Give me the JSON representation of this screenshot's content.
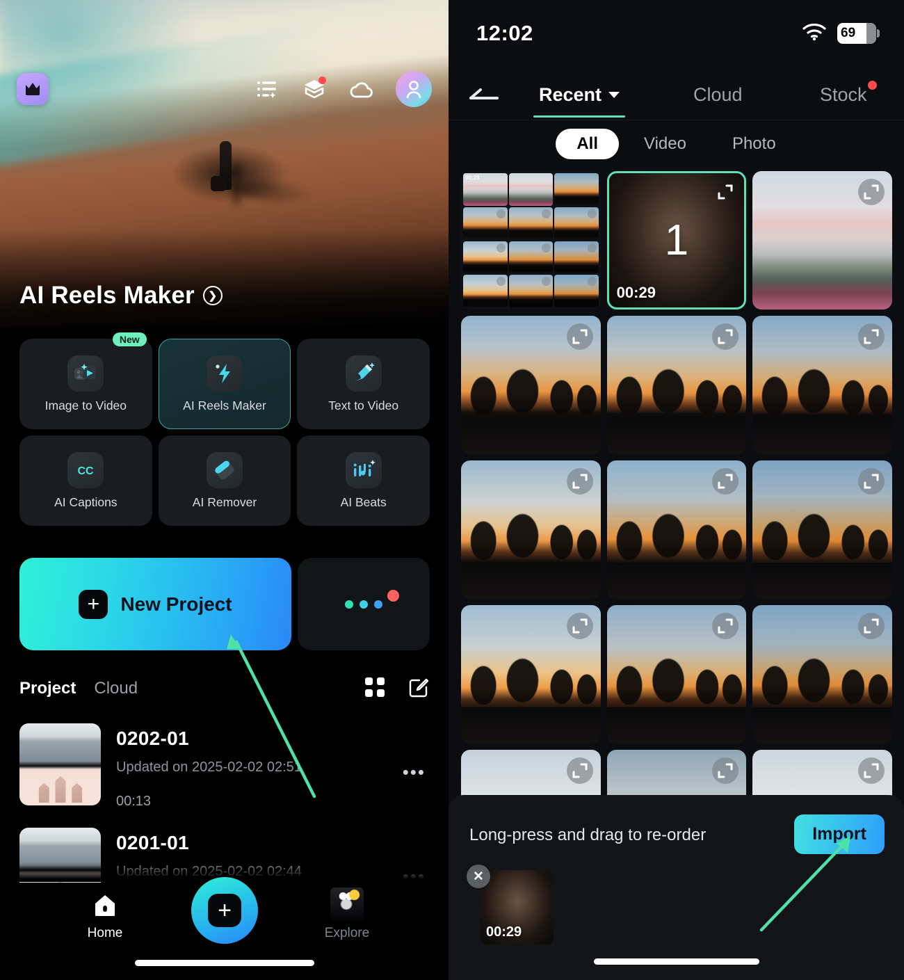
{
  "left_phone": {
    "header": {
      "crown_icon": "crown-icon",
      "icons": [
        {
          "name": "ai-script-icon",
          "badge": false
        },
        {
          "name": "tutorial-icon",
          "badge": true
        },
        {
          "name": "cloud-icon",
          "badge": false
        }
      ],
      "avatar": "profile-avatar"
    },
    "hero": {
      "title": "AI Reels Maker",
      "arrow_icon": "chevron-right-circle-icon"
    },
    "tools": [
      {
        "label": "Image to Video",
        "icon": "image-to-video-icon",
        "badge": "New",
        "active": false
      },
      {
        "label": "AI Reels Maker",
        "icon": "lightning-icon",
        "badge": "",
        "active": true
      },
      {
        "label": "Text  to Video",
        "icon": "pencil-icon",
        "badge": "",
        "active": false
      },
      {
        "label": "AI Captions",
        "icon": "cc-icon",
        "badge": "",
        "active": false
      },
      {
        "label": "AI Remover",
        "icon": "eraser-icon",
        "badge": "",
        "active": false
      },
      {
        "label": "AI Beats",
        "icon": "music-bars-icon",
        "badge": "",
        "active": false
      }
    ],
    "new_project": {
      "label": "New Project",
      "plus_icon": "plus-icon"
    },
    "more_card": {
      "icon": "three-dots-icon",
      "badge_dot": true
    },
    "project_header": {
      "tab_project": "Project",
      "tab_cloud": "Cloud",
      "grid_icon": "grid-view-icon",
      "edit_icon": "edit-icon"
    },
    "projects": [
      {
        "name": "0202-01",
        "updated": "Updated on 2025-02-02 02:51",
        "duration": "00:13",
        "more_icon": "more-options-icon"
      },
      {
        "name": "0201-01",
        "updated": "Updated on 2025-02-02 02:44",
        "duration": "",
        "more_icon": "more-options-icon"
      }
    ],
    "tabbar": {
      "home_label": "Home",
      "home_icon": "home-icon",
      "fab_icon": "plus-icon",
      "explore_label": "Explore",
      "explore_icon": "explore-avatar-icon"
    }
  },
  "right_phone": {
    "statusbar": {
      "time": "12:02",
      "wifi_icon": "wifi-icon",
      "battery_level": "69"
    },
    "tabs": {
      "back_icon": "back-arrow-icon",
      "items": [
        {
          "label": "Recent",
          "selected": true,
          "has_caret": true,
          "badge": false
        },
        {
          "label": "Cloud",
          "selected": false,
          "has_caret": false,
          "badge": false
        },
        {
          "label": "Stock",
          "selected": false,
          "has_caret": false,
          "badge": true
        }
      ]
    },
    "filters": [
      {
        "label": "All",
        "selected": true
      },
      {
        "label": "Video",
        "selected": false
      },
      {
        "label": "Photo",
        "selected": false
      }
    ],
    "grid": [
      {
        "kind": "album",
        "album_duration": "00:29",
        "expand_icon": "expand-icon"
      },
      {
        "kind": "video",
        "selected": true,
        "order_number": "1",
        "duration": "00:29",
        "expand_icon": "expand-icon"
      },
      {
        "kind": "photo",
        "expand_icon": "expand-icon"
      },
      {
        "kind": "photo",
        "expand_icon": "expand-icon"
      },
      {
        "kind": "photo",
        "expand_icon": "expand-icon"
      },
      {
        "kind": "photo",
        "expand_icon": "expand-icon"
      },
      {
        "kind": "photo",
        "expand_icon": "expand-icon"
      },
      {
        "kind": "photo",
        "expand_icon": "expand-icon"
      },
      {
        "kind": "photo",
        "expand_icon": "expand-icon"
      },
      {
        "kind": "photo",
        "expand_icon": "expand-icon"
      },
      {
        "kind": "photo",
        "expand_icon": "expand-icon"
      },
      {
        "kind": "photo",
        "expand_icon": "expand-icon"
      },
      {
        "kind": "photo",
        "expand_icon": "expand-icon"
      },
      {
        "kind": "photo",
        "expand_icon": "expand-icon"
      },
      {
        "kind": "photo",
        "expand_icon": "expand-icon"
      }
    ],
    "bottom_sheet": {
      "hint": "Long-press and drag to re-order",
      "import_label": "Import",
      "selected_clip": {
        "duration": "00:29",
        "remove_icon": "close-icon"
      }
    }
  },
  "annotations": {
    "arrow_color": "#4fe2a8",
    "arrow_left_target": "new-project-button",
    "arrow_right_target": "import-button"
  },
  "colors": {
    "accent_mint": "#5fe0b6",
    "accent_cyan": "#2ff0d6",
    "accent_blue": "#2a86f7",
    "badge_red": "#ff4b4b",
    "new_badge": "#6ef0bd"
  }
}
